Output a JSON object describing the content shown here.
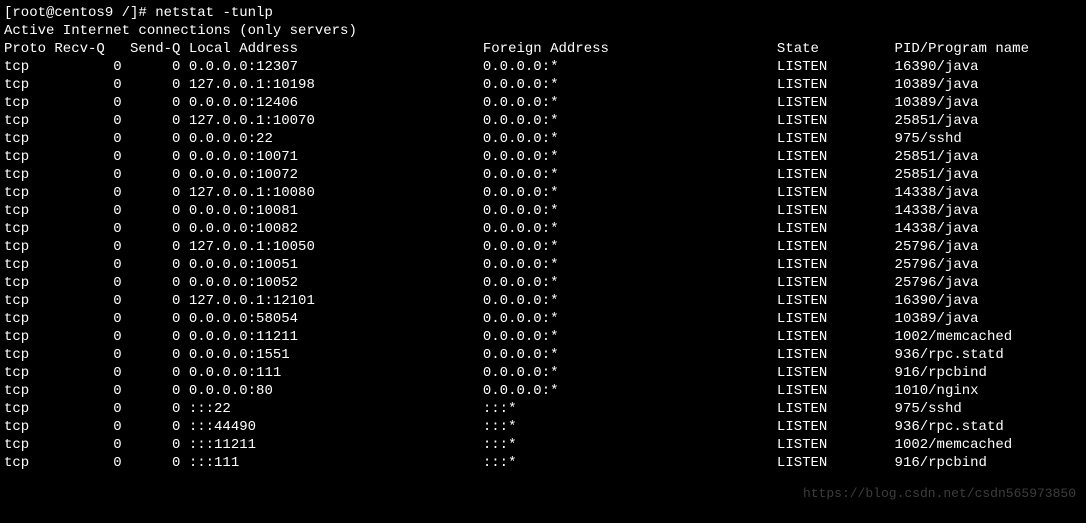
{
  "prompt": {
    "user_host": "[root@centos9 /]# ",
    "command": "netstat -tunlp"
  },
  "title_line": "Active Internet connections (only servers)",
  "headers": {
    "proto": "Proto",
    "recvq": "Recv-Q",
    "sendq": "Send-Q",
    "local": "Local Address",
    "foreign": "Foreign Address",
    "state": "State",
    "pid": "PID/Program name"
  },
  "rows": [
    {
      "proto": "tcp",
      "recvq": "0",
      "sendq": "0",
      "local": "0.0.0.0:12307",
      "foreign": "0.0.0.0:*",
      "state": "LISTEN",
      "pid": "16390/java"
    },
    {
      "proto": "tcp",
      "recvq": "0",
      "sendq": "0",
      "local": "127.0.0.1:10198",
      "foreign": "0.0.0.0:*",
      "state": "LISTEN",
      "pid": "10389/java"
    },
    {
      "proto": "tcp",
      "recvq": "0",
      "sendq": "0",
      "local": "0.0.0.0:12406",
      "foreign": "0.0.0.0:*",
      "state": "LISTEN",
      "pid": "10389/java"
    },
    {
      "proto": "tcp",
      "recvq": "0",
      "sendq": "0",
      "local": "127.0.0.1:10070",
      "foreign": "0.0.0.0:*",
      "state": "LISTEN",
      "pid": "25851/java"
    },
    {
      "proto": "tcp",
      "recvq": "0",
      "sendq": "0",
      "local": "0.0.0.0:22",
      "foreign": "0.0.0.0:*",
      "state": "LISTEN",
      "pid": "975/sshd"
    },
    {
      "proto": "tcp",
      "recvq": "0",
      "sendq": "0",
      "local": "0.0.0.0:10071",
      "foreign": "0.0.0.0:*",
      "state": "LISTEN",
      "pid": "25851/java"
    },
    {
      "proto": "tcp",
      "recvq": "0",
      "sendq": "0",
      "local": "0.0.0.0:10072",
      "foreign": "0.0.0.0:*",
      "state": "LISTEN",
      "pid": "25851/java"
    },
    {
      "proto": "tcp",
      "recvq": "0",
      "sendq": "0",
      "local": "127.0.0.1:10080",
      "foreign": "0.0.0.0:*",
      "state": "LISTEN",
      "pid": "14338/java"
    },
    {
      "proto": "tcp",
      "recvq": "0",
      "sendq": "0",
      "local": "0.0.0.0:10081",
      "foreign": "0.0.0.0:*",
      "state": "LISTEN",
      "pid": "14338/java"
    },
    {
      "proto": "tcp",
      "recvq": "0",
      "sendq": "0",
      "local": "0.0.0.0:10082",
      "foreign": "0.0.0.0:*",
      "state": "LISTEN",
      "pid": "14338/java"
    },
    {
      "proto": "tcp",
      "recvq": "0",
      "sendq": "0",
      "local": "127.0.0.1:10050",
      "foreign": "0.0.0.0:*",
      "state": "LISTEN",
      "pid": "25796/java"
    },
    {
      "proto": "tcp",
      "recvq": "0",
      "sendq": "0",
      "local": "0.0.0.0:10051",
      "foreign": "0.0.0.0:*",
      "state": "LISTEN",
      "pid": "25796/java"
    },
    {
      "proto": "tcp",
      "recvq": "0",
      "sendq": "0",
      "local": "0.0.0.0:10052",
      "foreign": "0.0.0.0:*",
      "state": "LISTEN",
      "pid": "25796/java"
    },
    {
      "proto": "tcp",
      "recvq": "0",
      "sendq": "0",
      "local": "127.0.0.1:12101",
      "foreign": "0.0.0.0:*",
      "state": "LISTEN",
      "pid": "16390/java"
    },
    {
      "proto": "tcp",
      "recvq": "0",
      "sendq": "0",
      "local": "0.0.0.0:58054",
      "foreign": "0.0.0.0:*",
      "state": "LISTEN",
      "pid": "10389/java"
    },
    {
      "proto": "tcp",
      "recvq": "0",
      "sendq": "0",
      "local": "0.0.0.0:11211",
      "foreign": "0.0.0.0:*",
      "state": "LISTEN",
      "pid": "1002/memcached"
    },
    {
      "proto": "tcp",
      "recvq": "0",
      "sendq": "0",
      "local": "0.0.0.0:1551",
      "foreign": "0.0.0.0:*",
      "state": "LISTEN",
      "pid": "936/rpc.statd"
    },
    {
      "proto": "tcp",
      "recvq": "0",
      "sendq": "0",
      "local": "0.0.0.0:111",
      "foreign": "0.0.0.0:*",
      "state": "LISTEN",
      "pid": "916/rpcbind"
    },
    {
      "proto": "tcp",
      "recvq": "0",
      "sendq": "0",
      "local": "0.0.0.0:80",
      "foreign": "0.0.0.0:*",
      "state": "LISTEN",
      "pid": "1010/nginx"
    },
    {
      "proto": "tcp",
      "recvq": "0",
      "sendq": "0",
      "local": ":::22",
      "foreign": ":::*",
      "state": "LISTEN",
      "pid": "975/sshd"
    },
    {
      "proto": "tcp",
      "recvq": "0",
      "sendq": "0",
      "local": ":::44490",
      "foreign": ":::*",
      "state": "LISTEN",
      "pid": "936/rpc.statd"
    },
    {
      "proto": "tcp",
      "recvq": "0",
      "sendq": "0",
      "local": ":::11211",
      "foreign": ":::*",
      "state": "LISTEN",
      "pid": "1002/memcached"
    },
    {
      "proto": "tcp",
      "recvq": "0",
      "sendq": "0",
      "local": ":::111",
      "foreign": ":::*",
      "state": "LISTEN",
      "pid": "916/rpcbind"
    }
  ],
  "columns": {
    "proto_w": 6,
    "recvq_w": 9,
    "sendq_w": 7,
    "local_w": 35,
    "foreign_w": 35,
    "state_w": 14
  },
  "watermark": "https://blog.csdn.net/csdn565973850"
}
